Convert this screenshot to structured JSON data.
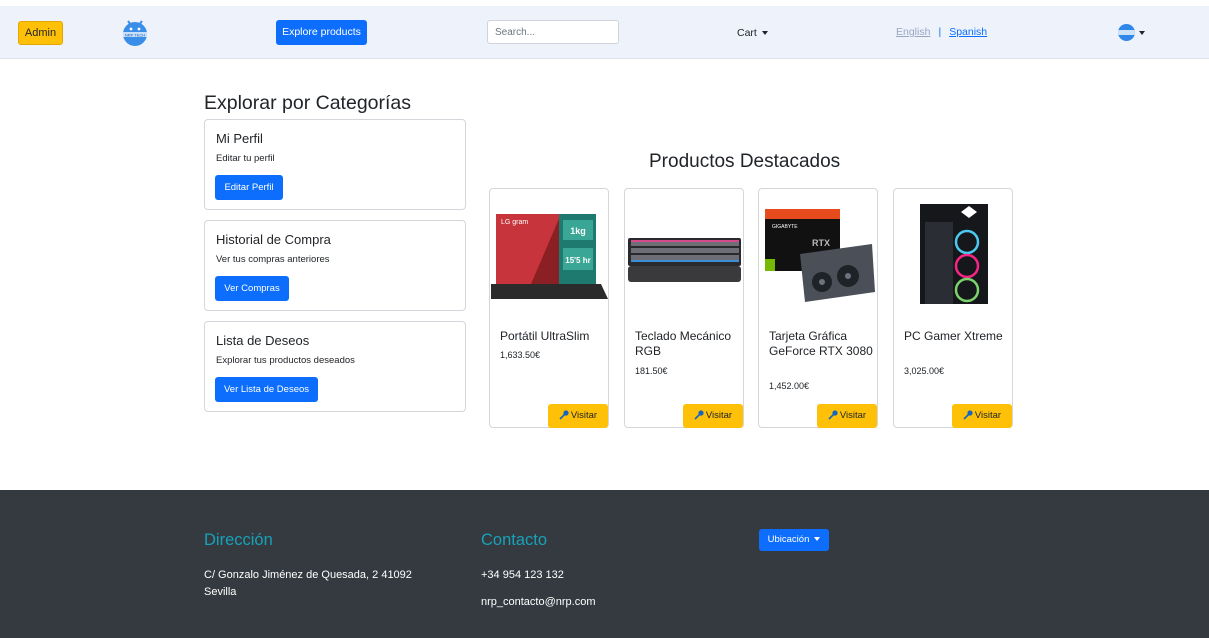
{
  "navbar": {
    "admin_label": "Admin",
    "explore_label": "Explore products",
    "search_placeholder": "Search...",
    "cart_label": "Cart",
    "lang_english": "English",
    "lang_separator": "|",
    "lang_spanish": "Spanish",
    "logo_text": "NRP TECH"
  },
  "categories": {
    "title": "Explorar por Categorías",
    "cards": [
      {
        "title": "Mi Perfil",
        "desc": "Editar tu perfil",
        "button": "Editar Perfil"
      },
      {
        "title": "Historial de Compra",
        "desc": "Ver tus compras anteriores",
        "button": "Ver Compras"
      },
      {
        "title": "Lista de Deseos",
        "desc": "Explorar tus productos deseados",
        "button": "Ver Lista de Deseos"
      }
    ]
  },
  "products": {
    "title": "Productos Destacados",
    "visit_label": "Visitar",
    "items": [
      {
        "name": "Portátil UltraSlim",
        "price": "1,633.50€",
        "icon": "laptop-image",
        "badge_main": "1kg",
        "badge_sub": "15'5 hr",
        "brand": "LG gram"
      },
      {
        "name": "Teclado Mecánico RGB",
        "price": "181.50€",
        "icon": "keyboard-image"
      },
      {
        "name": "Tarjeta Gráfica GeForce RTX 3080",
        "price": "1,452.00€",
        "icon": "gpu-image",
        "brand": "GIGABYTE",
        "badge_main": "RTX"
      },
      {
        "name": "PC Gamer Xtreme",
        "price": "3,025.00€",
        "icon": "pc-tower-image"
      }
    ]
  },
  "footer": {
    "address_title": "Dirección",
    "address_line1": "C/ Gonzalo Jiménez de Quesada, 2 41092",
    "address_line2": "Sevilla",
    "contact_title": "Contacto",
    "phone": "+34 954 123 132",
    "email": "nrp_contacto@nrp.com",
    "location_button": "Ubicación"
  },
  "colors": {
    "primary": "#0d6efd",
    "warning": "#ffc107",
    "footer_bg": "#343a40",
    "footer_heading": "#17a2b8",
    "navbar_bg": "#eef3fb"
  }
}
